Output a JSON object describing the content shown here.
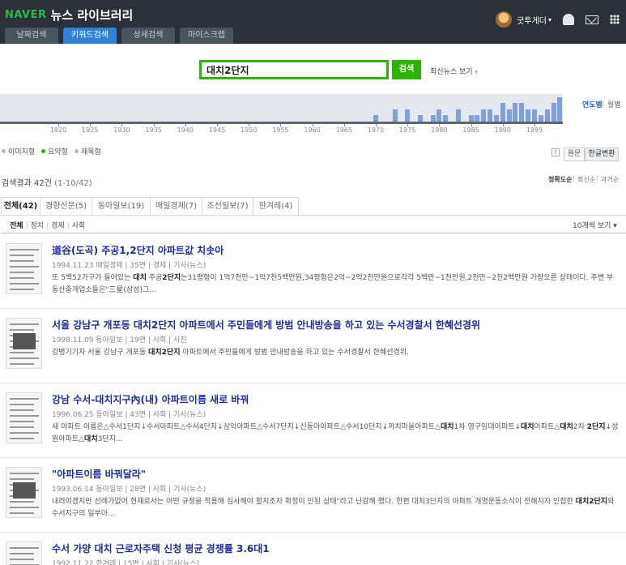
{
  "header": {
    "brand": "NAVER",
    "title": "뉴스 라이브러리",
    "tabs": [
      "날짜검색",
      "키워드검색",
      "상세검색",
      "마이스크랩"
    ],
    "active_tab": 1,
    "user_name": "굿투게더",
    "caret": "▾"
  },
  "search": {
    "query": "대치2단지",
    "button_label": "검색",
    "recent_link": "최신뉴스 보기 ›"
  },
  "timeline": {
    "labels": [
      "1920",
      "1925",
      "1930",
      "1935",
      "1940",
      "1945",
      "1950",
      "1955",
      "1960",
      "1965",
      "1970",
      "1975",
      "1980",
      "1985",
      "1990",
      "1995"
    ],
    "view_year": "연도별",
    "view_month": "월별"
  },
  "chart_data": {
    "type": "bar",
    "x": [
      1970,
      1973,
      1975,
      1977,
      1979,
      1980,
      1981,
      1983,
      1985,
      1986,
      1987,
      1988,
      1989,
      1990,
      1991,
      1992,
      1993,
      1994,
      1995,
      1996,
      1997,
      1998,
      1999
    ],
    "values": [
      1,
      2,
      2,
      1,
      1,
      2,
      1,
      2,
      1,
      1,
      2,
      2,
      1,
      3,
      2,
      3,
      3,
      2,
      2,
      1,
      2,
      3,
      4
    ],
    "xlim": [
      1918,
      2000
    ]
  },
  "options": {
    "radios": [
      {
        "label": "이미지형",
        "selected": false
      },
      {
        "label": "요약형",
        "selected": true
      },
      {
        "label": "제목형",
        "selected": false
      }
    ],
    "help": "?",
    "toggle_original": "원문",
    "toggle_hangul": "한글변환"
  },
  "results_info": {
    "count": "검색결과 42건",
    "range": "(1-10/42)",
    "sort_accuracy": "정확도순",
    "sort_latest": "최신순",
    "sort_oldest": "과거순"
  },
  "source_tabs": [
    "전체(42)",
    "경향신문(5)",
    "동아일보(19)",
    "매일경제(7)",
    "조선일보(7)",
    "한겨레(4)"
  ],
  "categories": [
    "전체",
    "정치",
    "경제",
    "사회"
  ],
  "per_page": "10개씩 보기 ▾",
  "results": [
    {
      "title": "道谷(도곡) 주공1,2단지 아파트값 치솟아",
      "meta": "1994.11.23 매일경제 | 35면 | 경제 | 기사(뉴스)",
      "body_parts": [
        "또 5백52가구가 들어있는 ",
        "대치",
        " 주공",
        "2단지",
        "는31평형이 1억7천만~1억7천5백만원,34평형은2억~2억2천만원으로각각 5백만~1천만원,2천만~2천2백만원 가량오른 상태이다. 주변 부동산중개업소들은\"三星(삼성)그..."
      ]
    },
    {
      "title": "서울 강남구 개포동 대치2단지 아파트에서 주민들에게 방범 안내방송을 하고 있는 수서경찰서 한혜선경위",
      "meta": "1998.11.09 동아일보 | 19면 | 사회 | 사진",
      "body_parts": [
        "강병기기자 서울 강남구 개포동 ",
        "대치2단지",
        " 아파트에서 주민들에게 방범 안내방송을 하고 있는 수서경찰서 한혜선경위."
      ]
    },
    {
      "title": "강남 수서-대치지구內(내) 아파트이름 새로 바꿔",
      "meta": "1996.06.25 동아일보 | 43면 | 사회 | 기사(뉴스)",
      "body_parts": [
        "새 아파트 이름은△수서1단지↓수서아파트△수서4단지↓삼익아파트△수서7단지↓신동아아파트△수서10단지↓까치마을아파트△",
        "대치",
        "1차 영구임대아파트↓",
        "대치",
        "아파트△",
        "대치",
        "2차 ",
        "2단지",
        "↓성원아파트△",
        "대치",
        "3단지..."
      ]
    },
    {
      "title": "\"아파트이름 바꿔달라\"",
      "meta": "1993.06.14 동아일보 | 28면 | 사회 | 기사(뉴스)",
      "body_parts": [
        "내려야겠지만 선례가없어 현재로서는 어떤 규정을 적용해 심사해야 할지조차 확정이 안된 상태\"라고 난감해 했다. 한편 대치3단지의 아파트 개명운동소식이 전해지자 인접한 ",
        "대치2단지",
        "와수서지구의 일부아..."
      ]
    },
    {
      "title": "수서 가양 대치 근로자주택 신청 평균 경쟁률 3.6대1",
      "meta": "1992.11.22 한겨레 | 15면 | 사회 | 기사(뉴스)",
      "body_parts": []
    }
  ]
}
